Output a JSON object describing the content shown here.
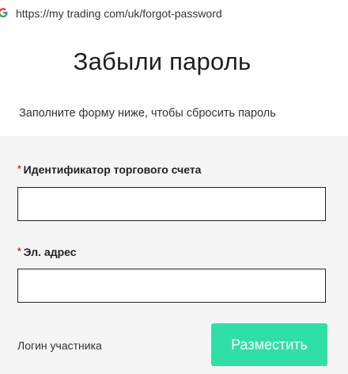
{
  "browser": {
    "url": "https://my trading com/uk/forgot-password",
    "icon": "google-g-icon"
  },
  "page": {
    "title": "Забыли пароль",
    "subtitle": "Заполните форму ниже, чтобы сбросить пароль"
  },
  "form": {
    "required_mark": "*",
    "account_label": "Идентификатор торгового счета",
    "account_value": "",
    "email_label": "Эл. адрес",
    "email_value": "",
    "login_link": "Логин участника",
    "submit_label": "Разместить"
  },
  "colors": {
    "accent": "#2ee0a6",
    "required": "#e02424",
    "panel_background": "#f5f5f5"
  }
}
